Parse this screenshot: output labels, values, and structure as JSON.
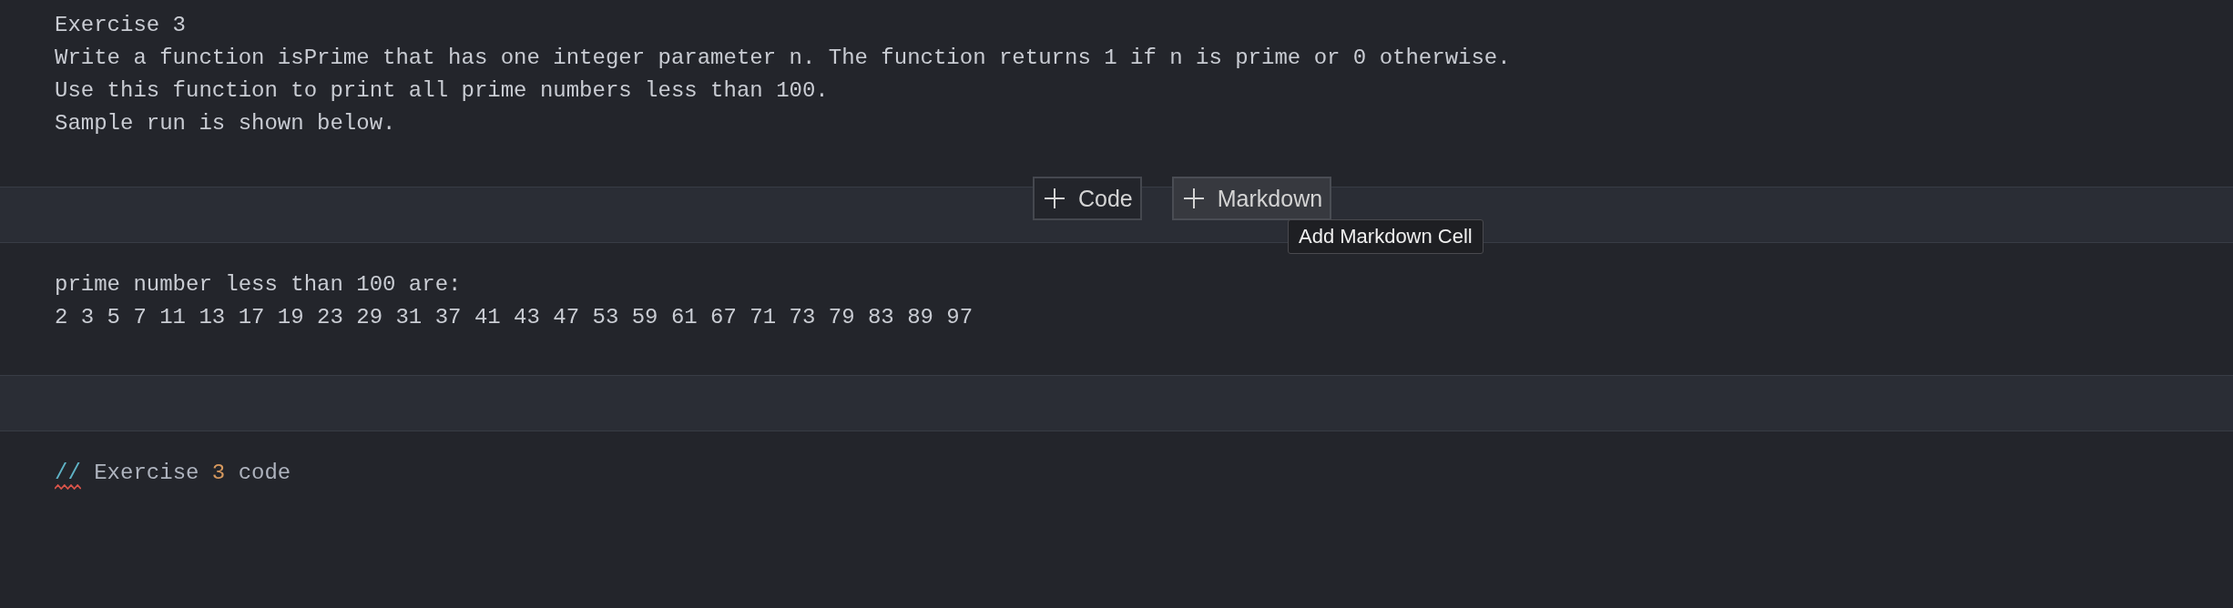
{
  "markdown_cell": {
    "lines": [
      "Exercise 3",
      "Write a function isPrime that has one integer parameter n. The function returns 1 if n is prime or 0 otherwise.",
      "Use this function to print all prime numbers less than 100.",
      "Sample run is shown below."
    ]
  },
  "add_cell_bar": {
    "buttons": [
      {
        "label": "Code",
        "hovered": false
      },
      {
        "label": "Markdown",
        "hovered": true
      }
    ],
    "tooltip": "Add Markdown Cell"
  },
  "output_cell": {
    "lines": [
      "prime number less than 100 are:",
      "2 3 5 7 11 13 17 19 23 29 31 37 41 43 47 53 59 61 67 71 73 79 83 89 97"
    ]
  },
  "code_cell": {
    "tokens": [
      {
        "text": "//",
        "kind": "comment",
        "error": true
      },
      {
        "text": " Exercise ",
        "kind": "plain",
        "error": false
      },
      {
        "text": "3",
        "kind": "number",
        "error": false
      },
      {
        "text": " code",
        "kind": "plain",
        "error": false
      }
    ]
  }
}
